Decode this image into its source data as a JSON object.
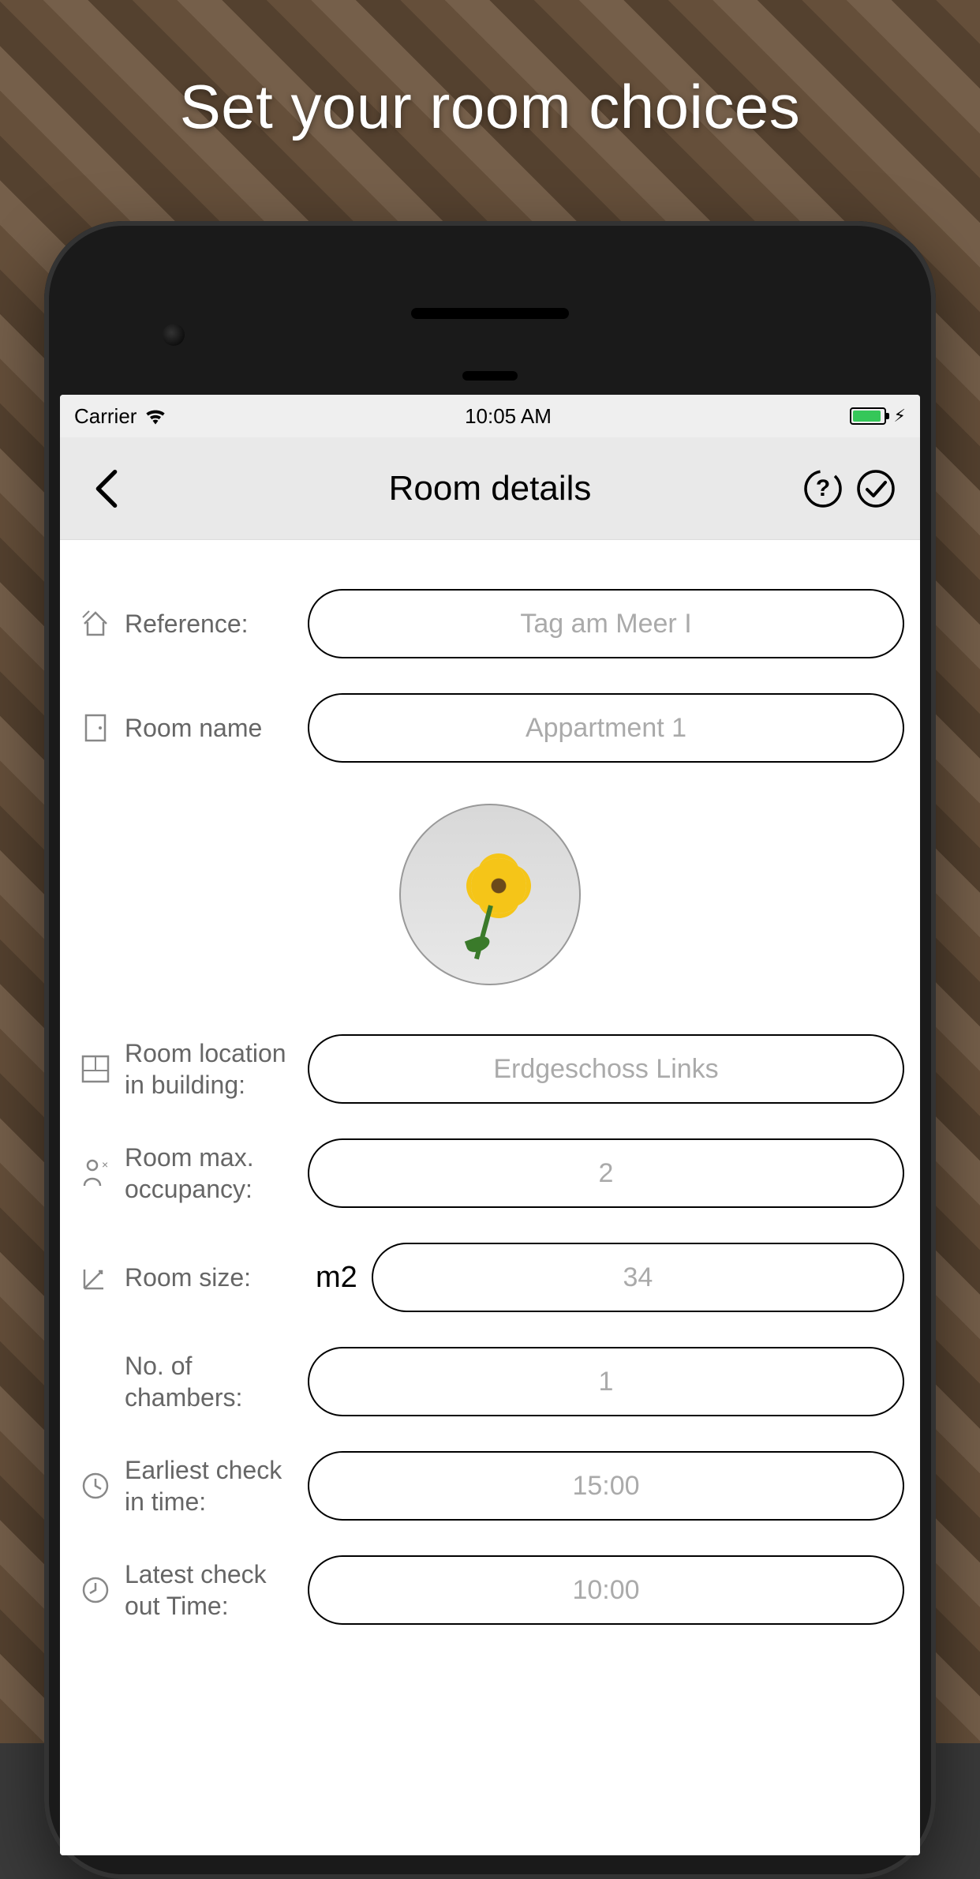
{
  "promo": {
    "title": "Set your room choices"
  },
  "status": {
    "carrier": "Carrier",
    "time": "10:05 AM"
  },
  "nav": {
    "title": "Room details"
  },
  "fields": {
    "reference": {
      "label": "Reference:",
      "value": "Tag am Meer I"
    },
    "room_name": {
      "label": "Room name",
      "value": "Appartment 1"
    },
    "location": {
      "label": "Room location in building:",
      "value": "Erdgeschoss Links"
    },
    "occupancy": {
      "label": "Room max. occupancy:",
      "value": "2"
    },
    "size": {
      "label": "Room size:",
      "unit": "m2",
      "value": "34"
    },
    "chambers": {
      "label": "No. of chambers:",
      "value": "1"
    },
    "checkin": {
      "label": "Earliest check in time:",
      "value": "15:00"
    },
    "checkout": {
      "label": "Latest check out Time:",
      "value": "10:00"
    }
  }
}
